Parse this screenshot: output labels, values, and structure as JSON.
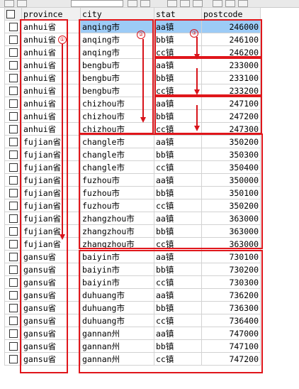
{
  "columns": {
    "province": "province",
    "city": "city",
    "stat": "stat",
    "postcode": "postcode"
  },
  "rows": [
    {
      "province": "anhui省",
      "city": "anqing市",
      "stat": "aa镇",
      "postcode": "246000"
    },
    {
      "province": "anhui省",
      "city": "anqing市",
      "stat": "bb镇",
      "postcode": "246100"
    },
    {
      "province": "anhui省",
      "city": "anqing市",
      "stat": "cc镇",
      "postcode": "246200"
    },
    {
      "province": "anhui省",
      "city": "bengbu市",
      "stat": "aa镇",
      "postcode": "233000"
    },
    {
      "province": "anhui省",
      "city": "bengbu市",
      "stat": "bb镇",
      "postcode": "233100"
    },
    {
      "province": "anhui省",
      "city": "bengbu市",
      "stat": "cc镇",
      "postcode": "233200"
    },
    {
      "province": "anhui省",
      "city": "chizhou市",
      "stat": "aa镇",
      "postcode": "247100"
    },
    {
      "province": "anhui省",
      "city": "chizhou市",
      "stat": "bb镇",
      "postcode": "247200"
    },
    {
      "province": "anhui省",
      "city": "chizhou市",
      "stat": "cc镇",
      "postcode": "247300"
    },
    {
      "province": "fujian省",
      "city": "changle市",
      "stat": "aa镇",
      "postcode": "350200"
    },
    {
      "province": "fujian省",
      "city": "changle市",
      "stat": "bb镇",
      "postcode": "350300"
    },
    {
      "province": "fujian省",
      "city": "changle市",
      "stat": "cc镇",
      "postcode": "350400"
    },
    {
      "province": "fujian省",
      "city": "fuzhou市",
      "stat": "aa镇",
      "postcode": "350000"
    },
    {
      "province": "fujian省",
      "city": "fuzhou市",
      "stat": "bb镇",
      "postcode": "350100"
    },
    {
      "province": "fujian省",
      "city": "fuzhou市",
      "stat": "cc镇",
      "postcode": "350200"
    },
    {
      "province": "fujian省",
      "city": "zhangzhou市",
      "stat": "aa镇",
      "postcode": "363000"
    },
    {
      "province": "fujian省",
      "city": "zhangzhou市",
      "stat": "bb镇",
      "postcode": "363000"
    },
    {
      "province": "fujian省",
      "city": "zhangzhou市",
      "stat": "cc镇",
      "postcode": "363000"
    },
    {
      "province": "gansu省",
      "city": "baiyin市",
      "stat": "aa镇",
      "postcode": "730100"
    },
    {
      "province": "gansu省",
      "city": "baiyin市",
      "stat": "bb镇",
      "postcode": "730200"
    },
    {
      "province": "gansu省",
      "city": "baiyin市",
      "stat": "cc镇",
      "postcode": "730300"
    },
    {
      "province": "gansu省",
      "city": "duhuang市",
      "stat": "aa镇",
      "postcode": "736200"
    },
    {
      "province": "gansu省",
      "city": "duhuang市",
      "stat": "bb镇",
      "postcode": "736300"
    },
    {
      "province": "gansu省",
      "city": "duhuang市",
      "stat": "cc镇",
      "postcode": "736400"
    },
    {
      "province": "gansu省",
      "city": "gannan州",
      "stat": "aa镇",
      "postcode": "747000"
    },
    {
      "province": "gansu省",
      "city": "gannan州",
      "stat": "bb镇",
      "postcode": "747100"
    },
    {
      "province": "gansu省",
      "city": "gannan州",
      "stat": "cc镇",
      "postcode": "747200"
    }
  ],
  "annotations": {
    "marker1": "①",
    "marker2": "②",
    "marker3": "③"
  },
  "colors": {
    "annotation_red": "#e0161b",
    "selected_header": "#3d7fd1",
    "row_highlight": "#9ccbf6"
  }
}
